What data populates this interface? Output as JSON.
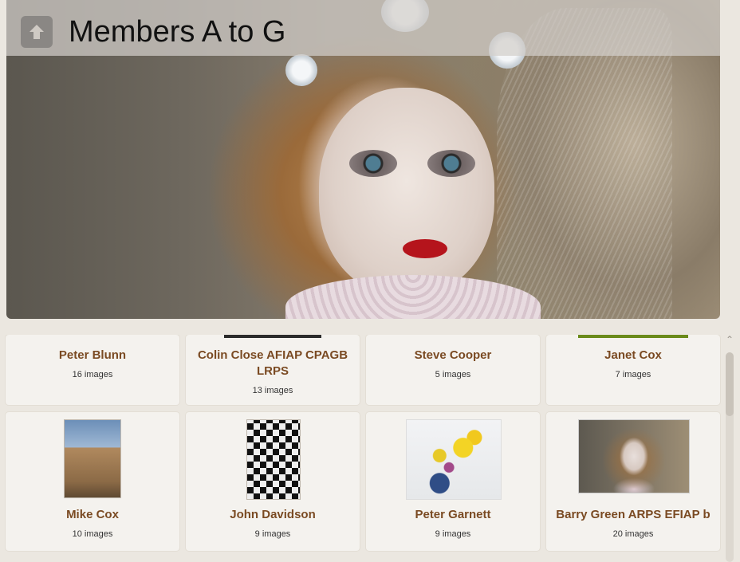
{
  "header": {
    "title": "Members A to G",
    "up_icon": "arrow-up-icon"
  },
  "members": [
    {
      "name": "Peter Blunn",
      "count": "16 images"
    },
    {
      "name": "Colin Close AFIAP CPAGB LRPS",
      "count": "13 images"
    },
    {
      "name": "Steve Cooper",
      "count": "5 images"
    },
    {
      "name": "Janet Cox",
      "count": "7 images"
    },
    {
      "name": "Mike Cox",
      "count": "10 images"
    },
    {
      "name": "John Davidson",
      "count": "9 images"
    },
    {
      "name": "Peter Garnett",
      "count": "9 images"
    },
    {
      "name": "Barry Green ARPS EFIAP b",
      "count": "20 images"
    }
  ],
  "colors": {
    "accent_text": "#7a4a22",
    "card_bg": "#f4f2ee",
    "page_bg": "#ebe7e0"
  }
}
